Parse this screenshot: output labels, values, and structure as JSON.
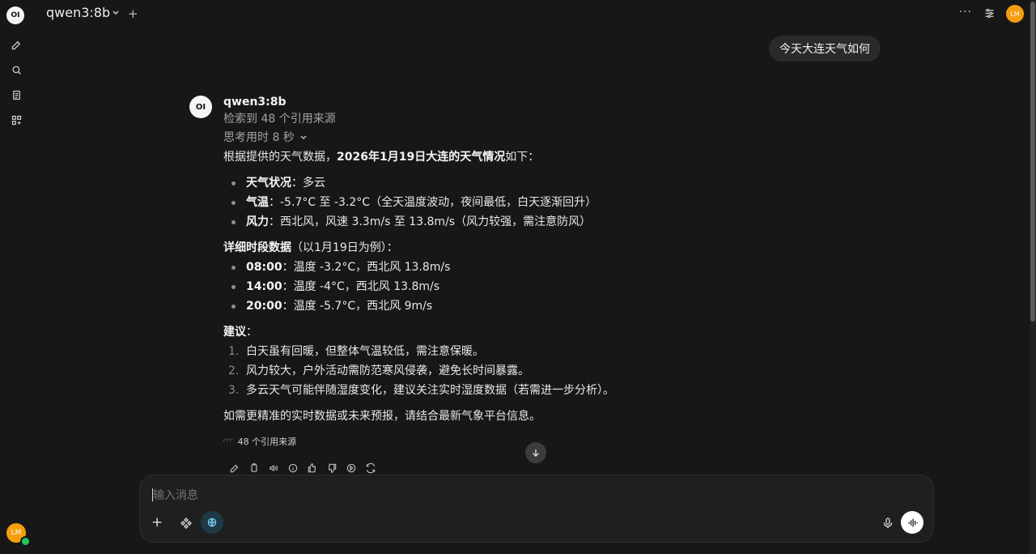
{
  "topbar": {
    "model_name": "qwen3:8b",
    "add_label": "+",
    "more_label": "···",
    "avatar_initials": "LM"
  },
  "sidebar": {
    "logo_text": "OI",
    "user_initials": "LM"
  },
  "chat": {
    "user_message": "今天大连天气如何",
    "assistant": {
      "avatar_text": "OI",
      "name": "qwen3:8b",
      "sources_text": "检索到 48 个引用来源",
      "thinking_text": "思考用时 8 秒",
      "intro_prefix": "根据提供的天气数据，",
      "intro_bold": "2026年1月19日大连的天气情况",
      "intro_suffix": "如下：",
      "summary": [
        {
          "label": "天气状况",
          "text": "：多云"
        },
        {
          "label": "气温",
          "text": "：-5.7°C 至 -3.2°C（全天温度波动，夜间最低，白天逐渐回升）"
        },
        {
          "label": "风力",
          "text": "：西北风，风速 3.3m/s 至 13.8m/s（风力较强，需注意防风）"
        }
      ],
      "detail_title_bold": "详细时段数据",
      "detail_title_suffix": "（以1月19日为例）：",
      "details": [
        {
          "label": "08:00",
          "text": "：温度 -3.2°C，西北风 13.8m/s"
        },
        {
          "label": "14:00",
          "text": "：温度 -4°C，西北风 13.8m/s"
        },
        {
          "label": "20:00",
          "text": "：温度 -5.7°C，西北风 9m/s"
        }
      ],
      "advice_title": "建议",
      "advice_suffix": "：",
      "advice": [
        {
          "num": "1.",
          "text": "白天虽有回暖，但整体气温较低，需注意保暖。"
        },
        {
          "num": "2.",
          "text": "风力较大，户外活动需防范寒风侵袭，避免长时间暴露。"
        },
        {
          "num": "3.",
          "text": "多云天气可能伴随湿度变化，建议关注实时湿度数据（若需进一步分析）。"
        }
      ],
      "closing": "如需更精准的实时数据或未来预报，请结合最新气象平台信息。",
      "source_count_label": "48 个引用来源"
    }
  },
  "composer": {
    "placeholder": "输入消息",
    "plus_label": "+"
  }
}
